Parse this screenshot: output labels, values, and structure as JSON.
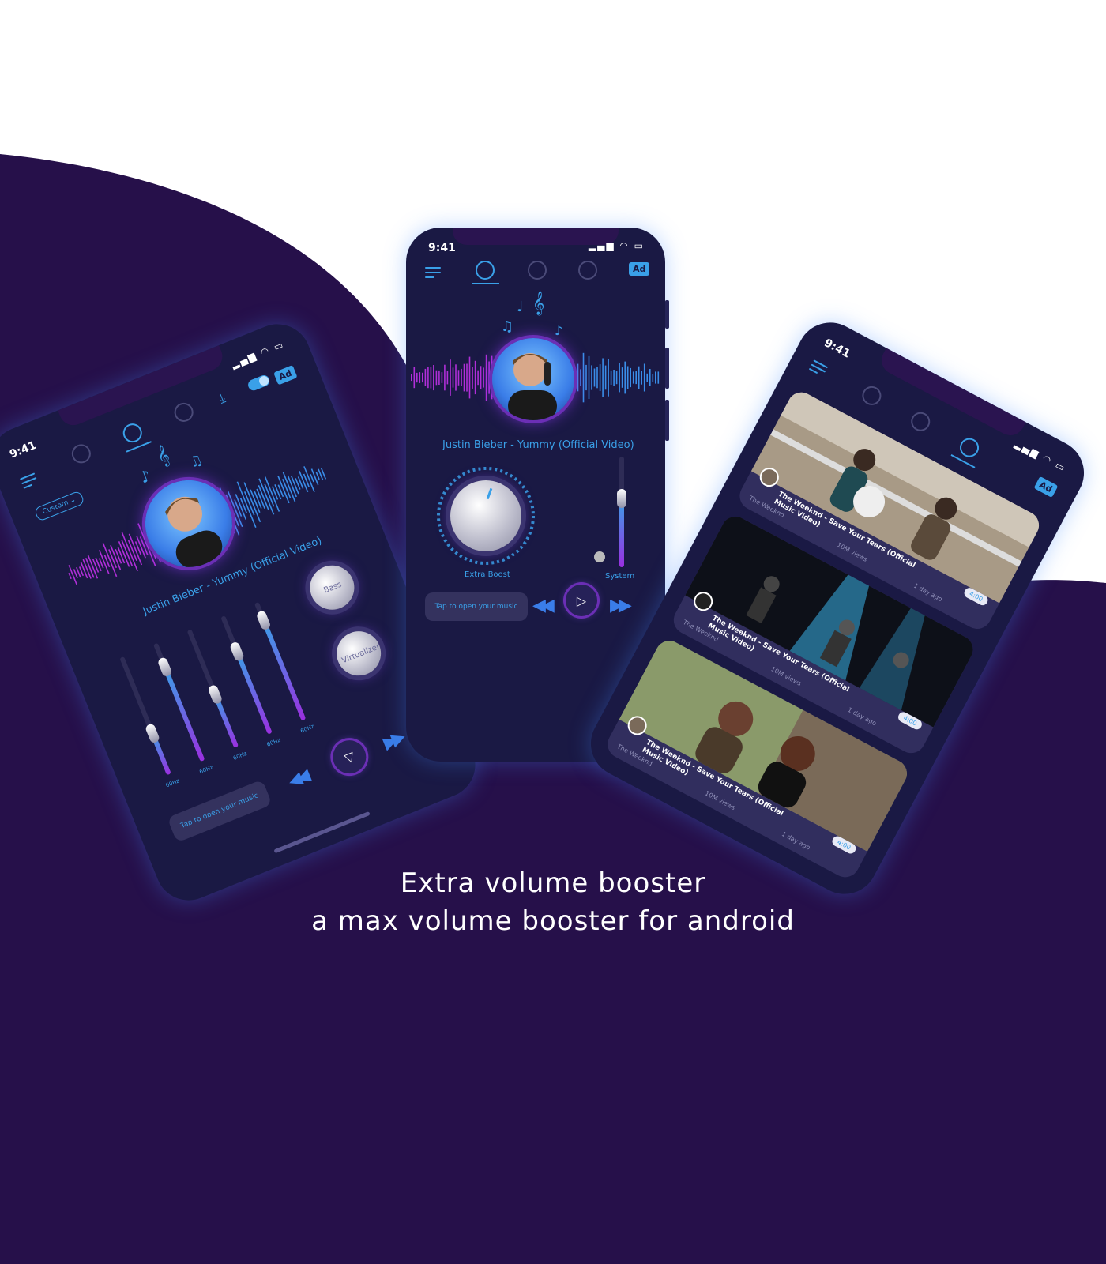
{
  "background": {
    "top_color": "#ffffff",
    "bottom_color": "#26104a"
  },
  "tagline": {
    "line1": "Extra volume booster",
    "line2": "a max volume booster for android"
  },
  "phone_center": {
    "time": "9:41",
    "ad": "Ad",
    "song_title": "Justin Bieber - Yummy (Official Video)",
    "extra_boost_label": "Extra Boost",
    "system_label": "System",
    "open_music_placeholder": "Tap to open your music"
  },
  "phone_left": {
    "time": "9:41",
    "ad": "Ad",
    "preset": "Custom",
    "song_title": "Justin Bieber - Yummy (Official Video)",
    "bass_label": "Bass",
    "virtualizer_label": "Virtualizer",
    "frequencies": [
      "60Hz",
      "60Hz",
      "60Hz",
      "60Hz",
      "60Hz"
    ],
    "eq_levels": [
      0.35,
      0.8,
      0.45,
      0.7,
      0.85
    ],
    "open_music_placeholder": "Tap to open your music"
  },
  "phone_right": {
    "time": "9:41",
    "ad": "Ad",
    "videos": [
      {
        "title": "The Weeknd - Save Your Tears (Official Music Video)",
        "channel": "The Weeknd",
        "views": "10M views",
        "age": "1 day ago",
        "duration": "4:00"
      },
      {
        "title": "The Weeknd - Save Your Tears (Official Music Video)",
        "channel": "The Weeknd",
        "views": "10M views",
        "age": "1 day ago",
        "duration": "4:00"
      },
      {
        "title": "The Weeknd - Save Your Tears (Official Music Video)",
        "channel": "The Weeknd",
        "views": "10M views",
        "age": "1 day ago",
        "duration": "4:00"
      }
    ]
  },
  "colors": {
    "accent": "#3aa0e8",
    "purple": "#9a2fe0",
    "phone_body": "#1a1944"
  }
}
